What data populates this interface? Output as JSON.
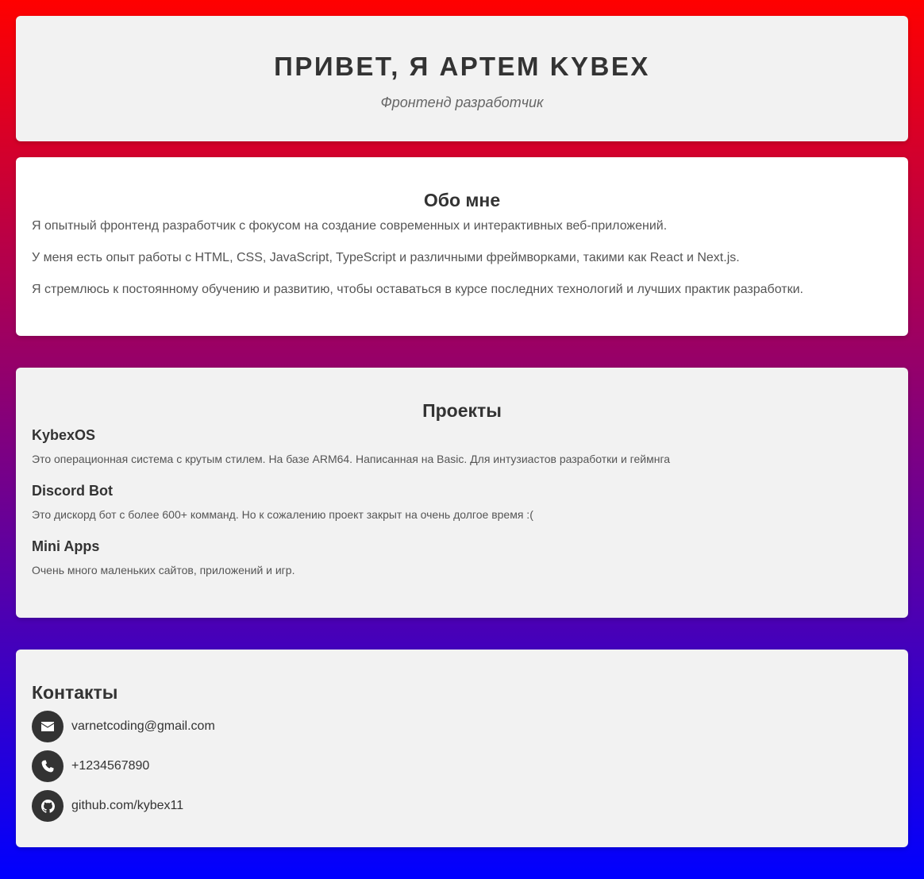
{
  "header": {
    "title": "ПРИВЕТ, Я АРТЕМ KYBEX",
    "subtitle": "Фронтенд разработчик"
  },
  "about": {
    "title": "Обо мне",
    "paragraphs": [
      "Я опытный фронтенд разработчик с фокусом на создание современных и интерактивных веб-приложений.",
      "У меня есть опыт работы с HTML, CSS, JavaScript, TypeScript и различными фреймворками, такими как React и Next.js.",
      "Я стремлюсь к постоянному обучению и развитию, чтобы оставаться в курсе последних технологий и лучших практик разработки."
    ]
  },
  "projects": {
    "title": "Проекты",
    "items": [
      {
        "name": "KybexOS",
        "description": "Это операционная система с крутым стилем. На базе ARM64. Написанная на Basic. Для интузиастов разработки и геймнга"
      },
      {
        "name": "Discord Bot",
        "description": "Это дискорд бот с более 600+ комманд. Но к сожалению проект закрыт на очень долгое время :("
      },
      {
        "name": "Mini Apps",
        "description": "Очень много маленьких сайтов, приложений и игр."
      }
    ]
  },
  "contacts": {
    "title": "Контакты",
    "items": [
      {
        "icon": "envelope-icon",
        "text": "varnetcoding@gmail.com"
      },
      {
        "icon": "phone-icon",
        "text": "+1234567890"
      },
      {
        "icon": "github-icon",
        "text": "github.com/kybex11"
      }
    ]
  },
  "colors": {
    "gradient_top": "#ff0000",
    "gradient_bottom": "#0000ff",
    "card_light": "#f2f2f2",
    "card_white": "#ffffff",
    "text_dark": "#333333",
    "text_muted": "#555555"
  }
}
